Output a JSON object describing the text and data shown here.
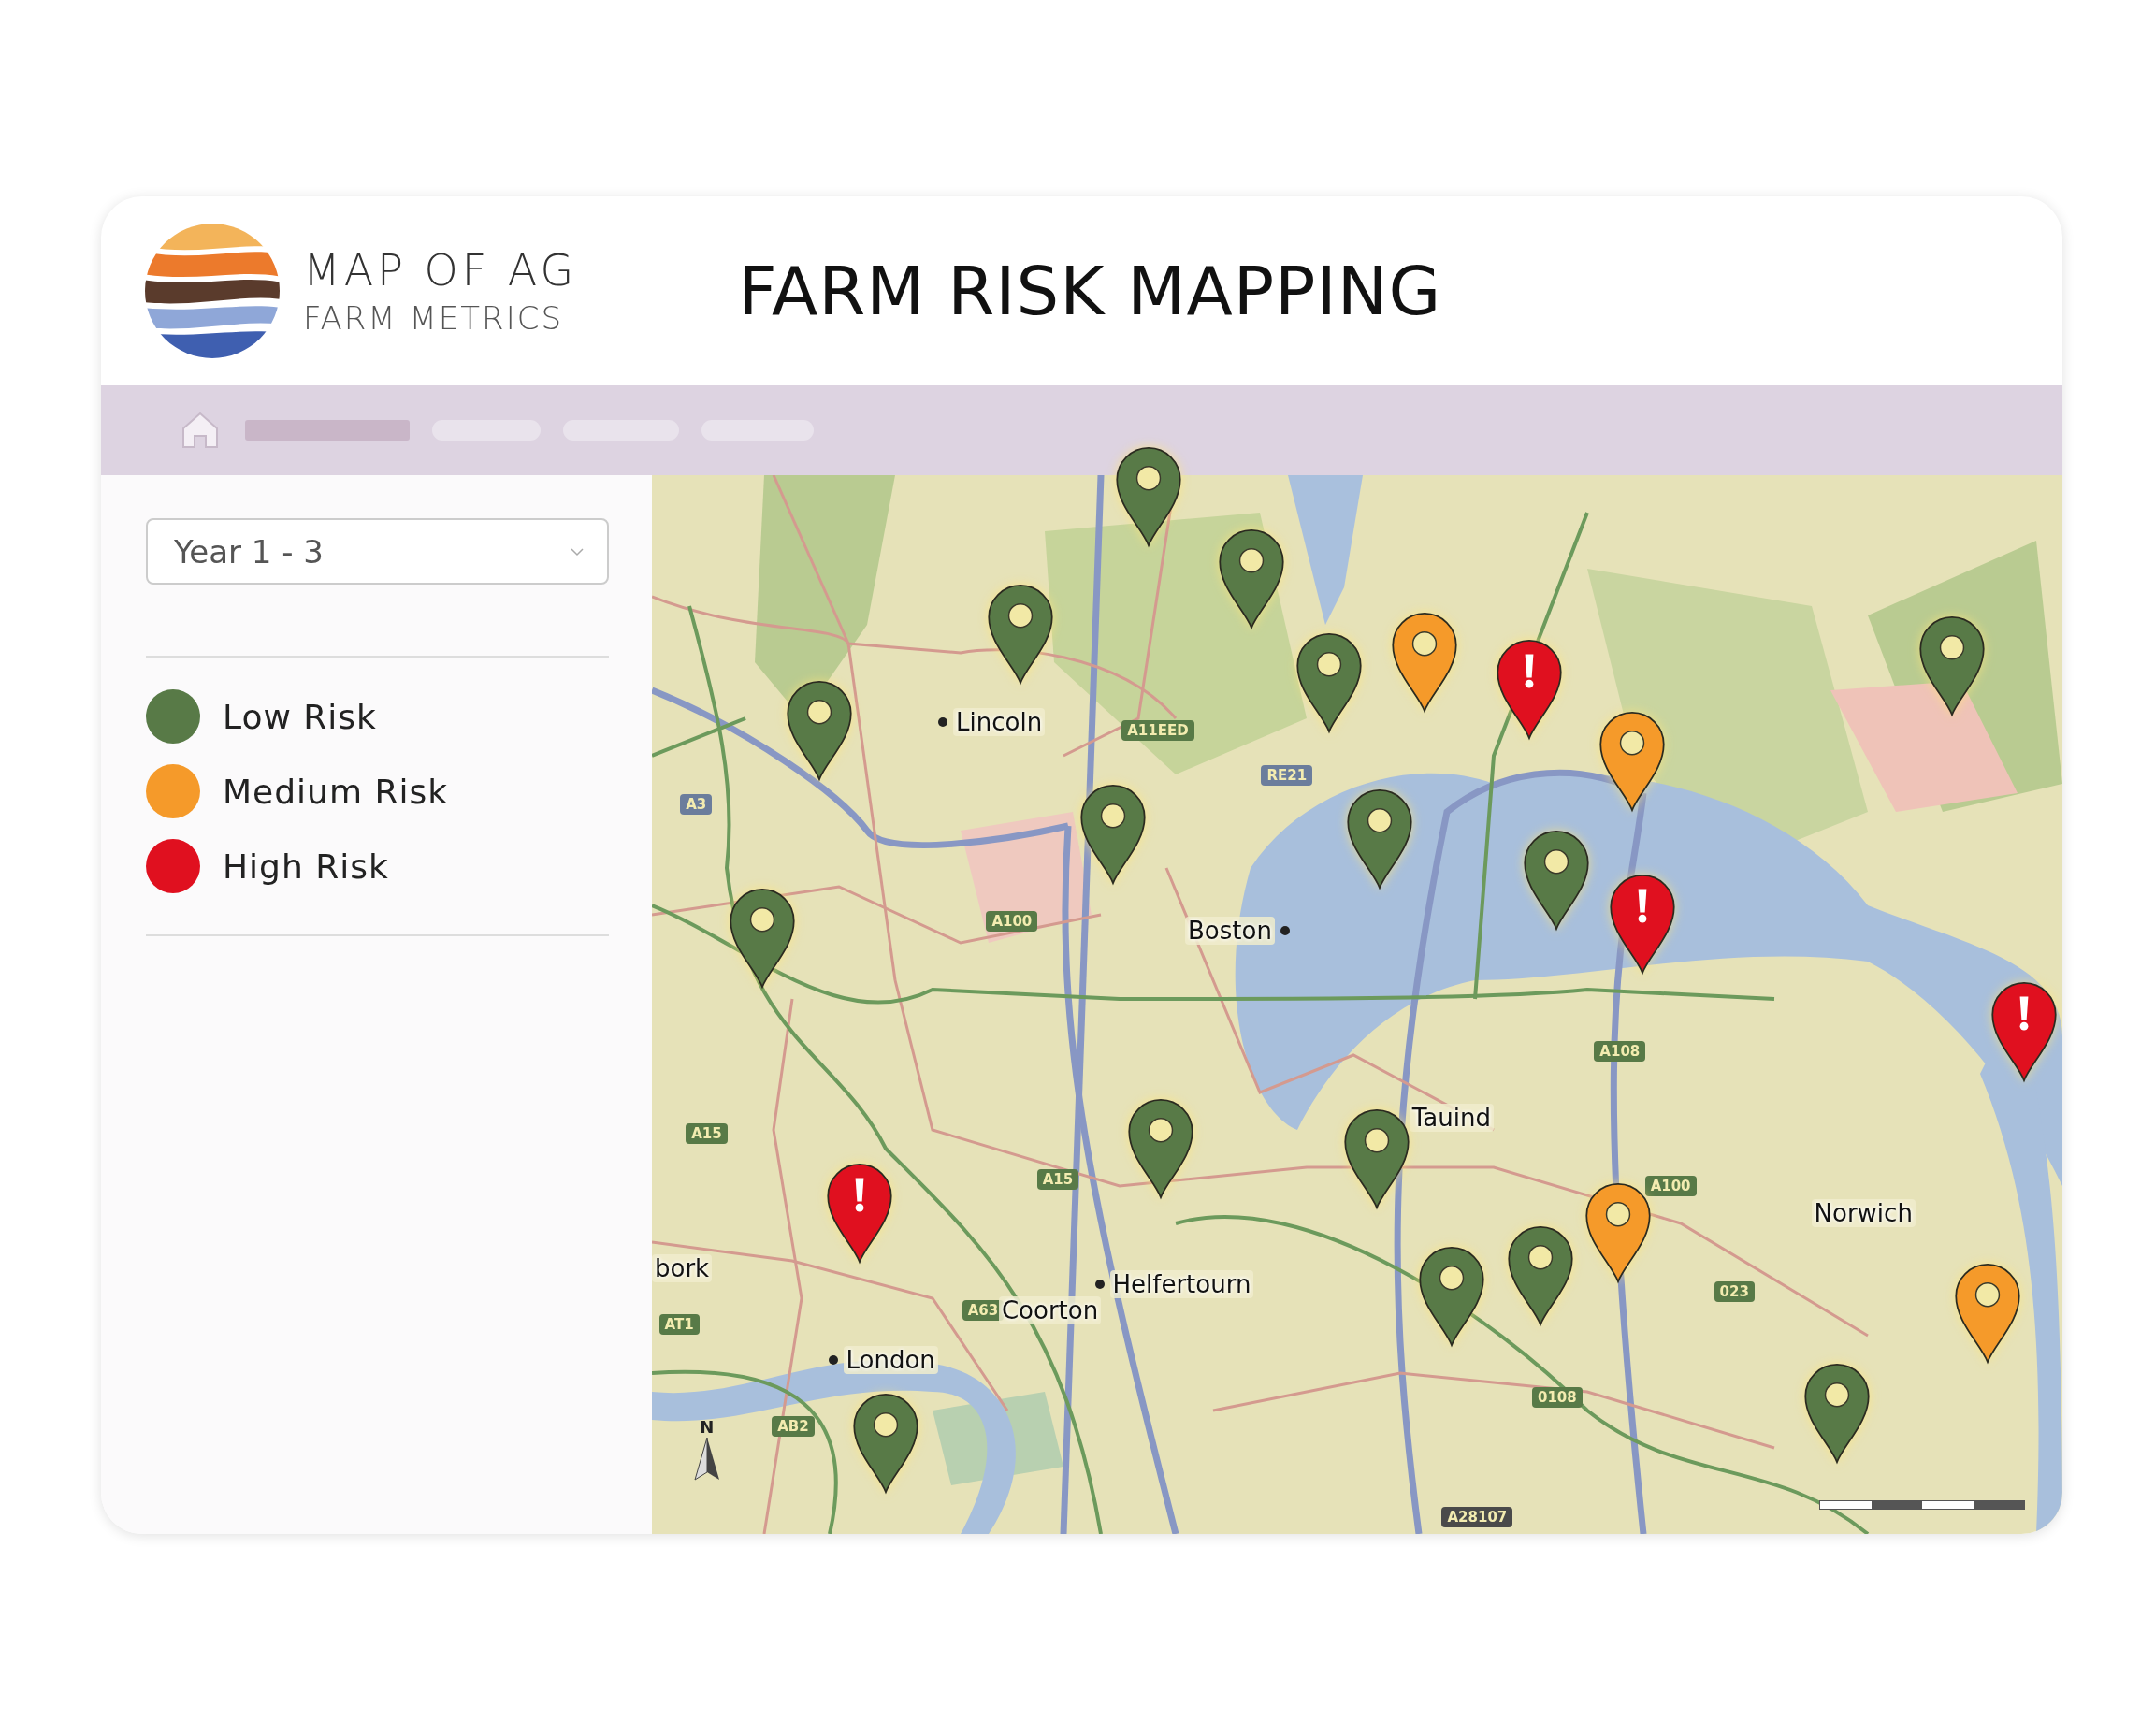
{
  "header": {
    "logo": {
      "line_1": "MAP OF AG",
      "line_2": "FARM METRICS"
    },
    "title": "FARM RISK MAPPING"
  },
  "sidebar": {
    "period_select": {
      "value": "Year 1 - 3"
    },
    "legend": [
      {
        "kind": "low",
        "label": "Low Risk",
        "color": "#587a47"
      },
      {
        "kind": "medium",
        "label": "Medium Risk",
        "color": "#f59a2a"
      },
      {
        "kind": "high",
        "label": "High Risk",
        "color": "#e0101f"
      }
    ]
  },
  "map": {
    "places": [
      {
        "name": "Lincoln"
      },
      {
        "name": "Boston"
      },
      {
        "name": "Tauind"
      },
      {
        "name": "Norwich"
      },
      {
        "name": "Helfertourn"
      },
      {
        "name": "Coorton"
      },
      {
        "name": "London"
      },
      {
        "name": "bork"
      }
    ],
    "road_labels": [
      {
        "text": "A3",
        "color": "#6b7d9c"
      },
      {
        "text": "A11EED",
        "color": "#587a47"
      },
      {
        "text": "RE21",
        "color": "#6b7d9c"
      },
      {
        "text": "A100",
        "color": "#587a47"
      },
      {
        "text": "A15",
        "color": "#587a47"
      },
      {
        "text": "A15",
        "color": "#587a47"
      },
      {
        "text": "AT1",
        "color": "#587a47"
      },
      {
        "text": "AB2",
        "color": "#587a47"
      },
      {
        "text": "A63",
        "color": "#587a47"
      },
      {
        "text": "A108",
        "color": "#587a47"
      },
      {
        "text": "A100",
        "color": "#587a47"
      },
      {
        "text": "023",
        "color": "#587a47"
      },
      {
        "text": "0108",
        "color": "#587a47"
      },
      {
        "text": "A28107",
        "color": "#4a4a4a"
      }
    ],
    "compass": "N",
    "pins": [
      {
        "kind": "low"
      },
      {
        "kind": "low"
      },
      {
        "kind": "low"
      },
      {
        "kind": "low"
      },
      {
        "kind": "low"
      },
      {
        "kind": "medium"
      },
      {
        "kind": "high"
      },
      {
        "kind": "medium"
      },
      {
        "kind": "low"
      },
      {
        "kind": "low"
      },
      {
        "kind": "low"
      },
      {
        "kind": "low"
      },
      {
        "kind": "high"
      },
      {
        "kind": "low"
      },
      {
        "kind": "high"
      },
      {
        "kind": "low"
      },
      {
        "kind": "low"
      },
      {
        "kind": "high"
      },
      {
        "kind": "medium"
      },
      {
        "kind": "low"
      },
      {
        "kind": "low"
      },
      {
        "kind": "medium"
      },
      {
        "kind": "low"
      },
      {
        "kind": "low"
      }
    ]
  }
}
